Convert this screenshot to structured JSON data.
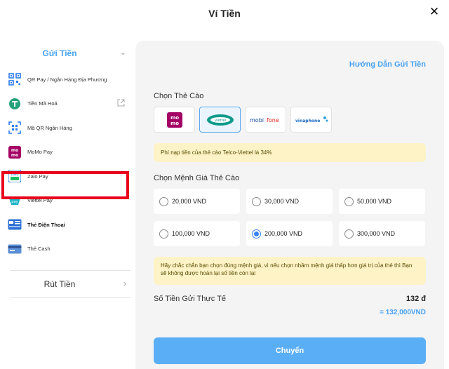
{
  "header": {
    "title": "Ví Tiền",
    "close_label": "✕"
  },
  "sidebar": {
    "deposit_label": "Gửi Tiền",
    "withdraw_label": "Rút Tiền",
    "items": [
      {
        "label": "QR Pay / Ngân Hàng Địa Phương",
        "icon": "qr-pay-icon"
      },
      {
        "label": "Tiền Mã Hoá",
        "icon": "tether-icon"
      },
      {
        "label": "Mã QR Ngân Hàng",
        "icon": "qr-scan-icon"
      },
      {
        "label": "MoMo Pay",
        "icon": "momo-icon"
      },
      {
        "label": "Zalo Pay",
        "icon": "zalo-icon"
      },
      {
        "label": "Viettel Pay",
        "icon": "viettel-pay-icon"
      },
      {
        "label": "Thẻ Điện Thoại",
        "icon": "phone-card-icon",
        "selected": true
      },
      {
        "label": "Thẻ Cash",
        "icon": "cash-card-icon"
      }
    ]
  },
  "main": {
    "guide_link": "Hướng Dẫn Gửi Tiền",
    "choose_card_label": "Chọn Thẻ Cào",
    "cards": [
      {
        "name": "momo",
        "text": "mo mo"
      },
      {
        "name": "viettel",
        "text": "viettel",
        "selected": true
      },
      {
        "name": "mobifone",
        "text": "mobifone"
      },
      {
        "name": "vinaphone",
        "text": "vinaphone"
      }
    ],
    "fee_notice": "Phí nạp tiền của thẻ cào Telco-Viettel là 34%",
    "choose_value_label": "Chọn Mệnh Giá Thẻ Cào",
    "options": [
      {
        "label": "20,000 VND",
        "selected": false
      },
      {
        "label": "30,000 VND",
        "selected": false
      },
      {
        "label": "50,000 VND",
        "selected": false
      },
      {
        "label": "100,000 VND",
        "selected": false
      },
      {
        "label": "200,000 VND",
        "selected": true
      },
      {
        "label": "300,000 VND",
        "selected": false
      }
    ],
    "warning": "Hãy chắc chắn bạn chọn đúng mệnh giá, vì nếu chọn nhầm mệnh giá thấp hơn giá trị của thẻ thì Bạn sẽ không được hoàn lại số tiền còn lại",
    "actual_label": "Số Tiền Gửi Thực Tế",
    "actual_amount": "132 đ",
    "converted_amount": "= 132,000VND",
    "submit_label": "Chuyển"
  },
  "colors": {
    "accent": "#4aa3f0",
    "highlight": "#e8001c",
    "notice_bg": "#fdf3c7",
    "button": "#5aaef5"
  }
}
